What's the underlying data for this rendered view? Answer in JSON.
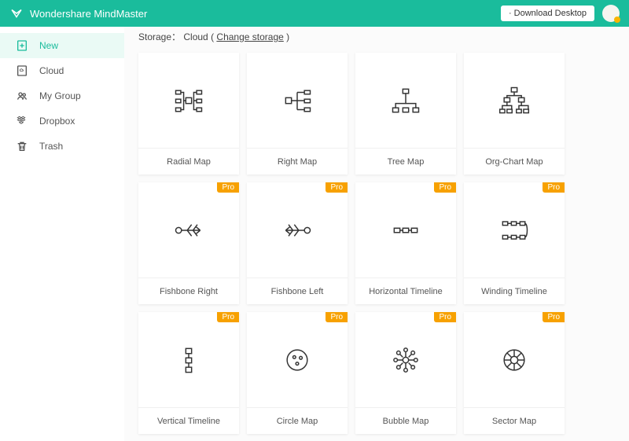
{
  "header": {
    "brand": "Wondershare MindMaster",
    "download": "· Download Desktop"
  },
  "sidebar": {
    "items": [
      {
        "label": "New"
      },
      {
        "label": "Cloud"
      },
      {
        "label": "My Group"
      },
      {
        "label": "Dropbox"
      },
      {
        "label": "Trash"
      }
    ]
  },
  "storage": {
    "prefix": "Storage：",
    "location": "Cloud",
    "change": "Change storage"
  },
  "templates": [
    {
      "label": "Radial Map",
      "pro": false
    },
    {
      "label": "Right Map",
      "pro": false
    },
    {
      "label": "Tree Map",
      "pro": false
    },
    {
      "label": "Org-Chart Map",
      "pro": false
    },
    {
      "label": "Fishbone Right",
      "pro": true
    },
    {
      "label": "Fishbone Left",
      "pro": true
    },
    {
      "label": "Horizontal Timeline",
      "pro": true
    },
    {
      "label": "Winding Timeline",
      "pro": true
    },
    {
      "label": "Vertical Timeline",
      "pro": true
    },
    {
      "label": "Circle Map",
      "pro": true
    },
    {
      "label": "Bubble Map",
      "pro": true
    },
    {
      "label": "Sector Map",
      "pro": true
    }
  ],
  "pro_label": "Pro"
}
